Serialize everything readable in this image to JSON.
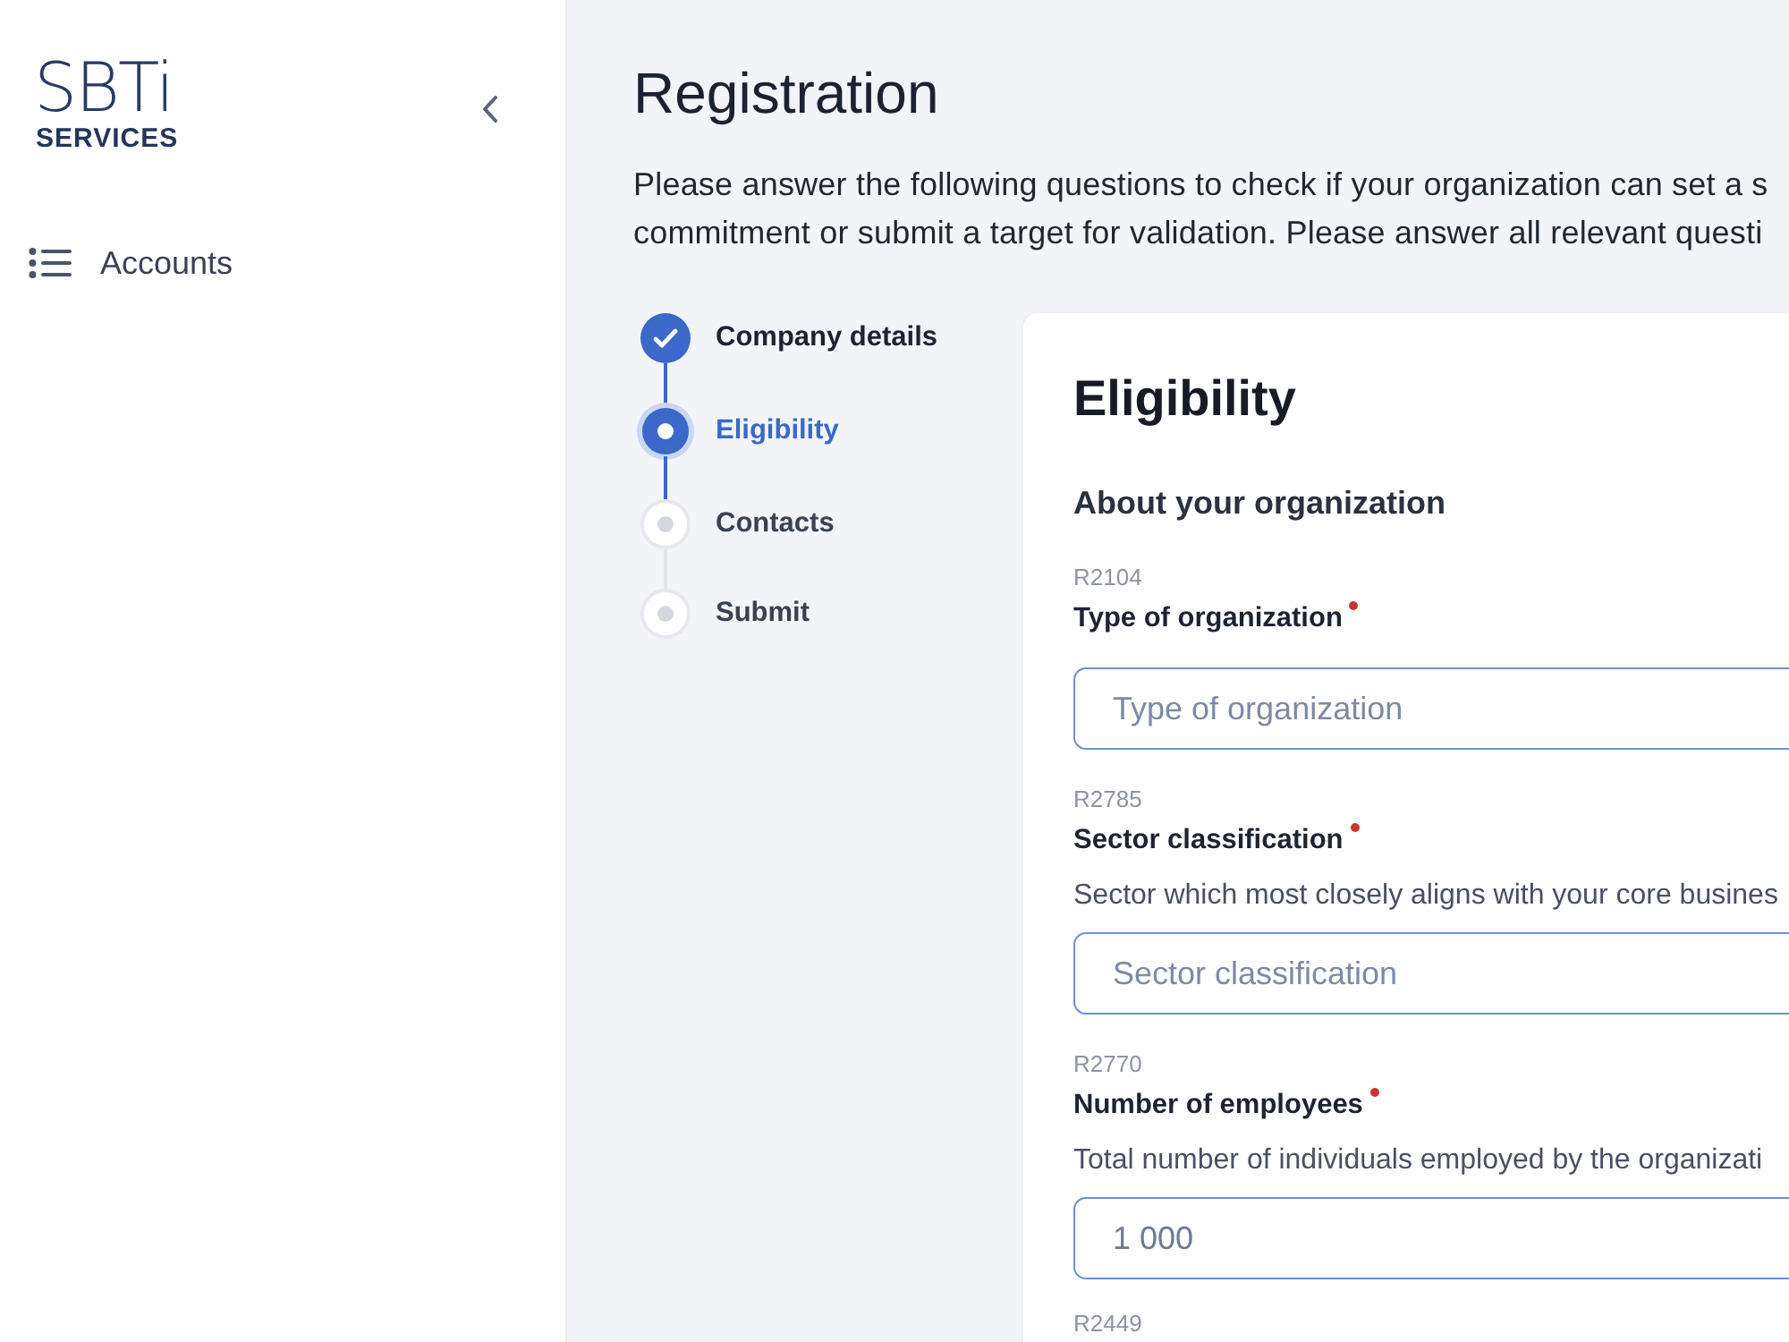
{
  "sidebar": {
    "logo": {
      "title": "SBTi",
      "subtitle": "SERVICES"
    },
    "nav_items": [
      {
        "label": "Accounts",
        "selected": false
      }
    ]
  },
  "page": {
    "title": "Registration",
    "intro_lines": [
      "Please answer the following questions to check if your organization can set a s",
      "commitment or submit a target for validation. Please answer all relevant questi"
    ]
  },
  "steps": [
    {
      "label": "Company details",
      "completed": true,
      "selected": false
    },
    {
      "label": "Eligibility",
      "completed": false,
      "selected": true
    },
    {
      "label": "Contacts",
      "completed": false,
      "selected": false
    },
    {
      "label": "Submit",
      "completed": false,
      "selected": false
    }
  ],
  "form": {
    "title": "Eligibility",
    "section": "About your organization",
    "fields": [
      {
        "code": "R2104",
        "label": "Type of organization",
        "required": true,
        "placeholder": "Type of organization"
      },
      {
        "code": "R2785",
        "label": "Sector classification",
        "required": true,
        "description": "Sector which most closely aligns with your core busines",
        "placeholder": "Sector classification"
      },
      {
        "code": "R2770",
        "label": "Number of employees",
        "required": true,
        "description": "Total number of individuals employed by the organizati",
        "value": "1 000"
      },
      {
        "code": "R2449"
      }
    ]
  }
}
